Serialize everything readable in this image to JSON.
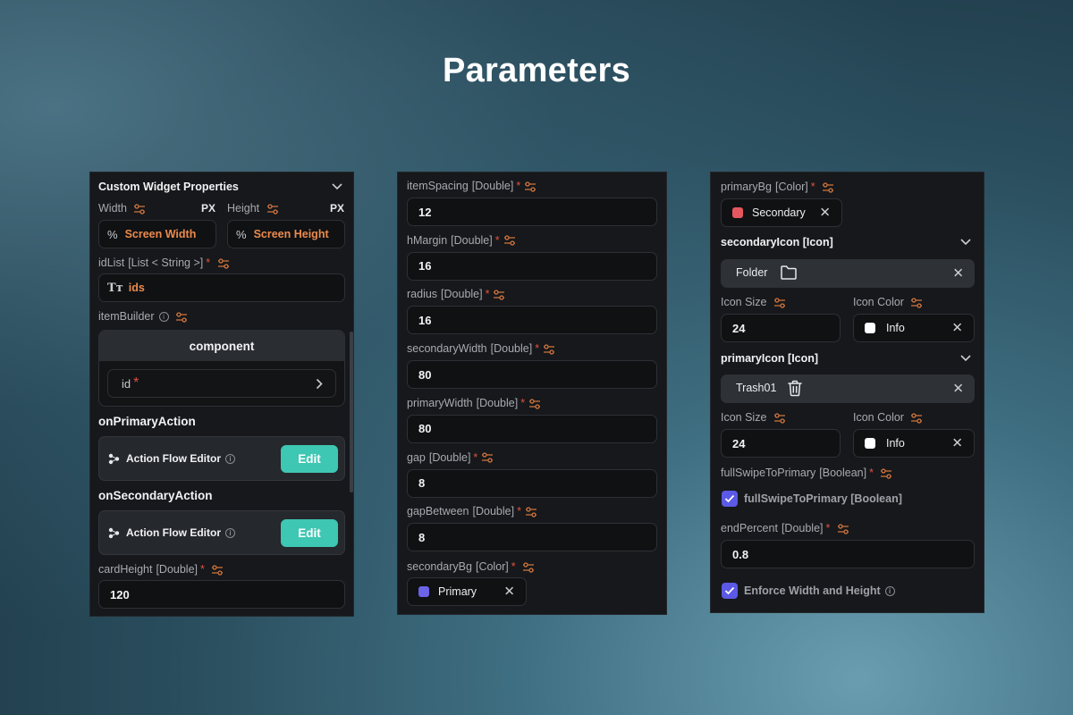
{
  "page_title": "Parameters",
  "panel1": {
    "header": "Custom Widget Properties",
    "width_label": "Width",
    "width_unit": "PX",
    "height_label": "Height",
    "height_unit": "PX",
    "width_value": "Screen Width",
    "height_value": "Screen Height",
    "idlist_label": "idList",
    "idlist_type": "[List < String >]",
    "idlist_value": "ids",
    "itembuilder_label": "itemBuilder",
    "component_label": "component",
    "id_label": "id",
    "on_primary_action": "onPrimaryAction",
    "on_secondary_action": "onSecondaryAction",
    "action_flow_editor": "Action Flow Editor",
    "edit_label": "Edit",
    "cardheight_label": "cardHeight",
    "cardheight_type": "[Double]",
    "cardheight_value": "120"
  },
  "panel2": {
    "fields": [
      {
        "name": "itemSpacing",
        "type": "[Double]",
        "value": "12"
      },
      {
        "name": "hMargin",
        "type": "[Double]",
        "value": "16"
      },
      {
        "name": "radius",
        "type": "[Double]",
        "value": "16"
      },
      {
        "name": "secondaryWidth",
        "type": "[Double]",
        "value": "80"
      },
      {
        "name": "primaryWidth",
        "type": "[Double]",
        "value": "80"
      },
      {
        "name": "gap",
        "type": "[Double]",
        "value": "8"
      },
      {
        "name": "gapBetween",
        "type": "[Double]",
        "value": "8"
      }
    ],
    "secondarybg_label": "secondaryBg",
    "secondarybg_type": "[Color]",
    "secondarybg_value": "Primary",
    "secondarybg_color": "#6b63e8"
  },
  "panel3": {
    "primarybg_label": "primaryBg",
    "primarybg_type": "[Color]",
    "primarybg_value": "Secondary",
    "primarybg_color": "#e5575e",
    "secondary_icon_label": "secondaryIcon",
    "secondary_icon_type": "[Icon]",
    "secondary_icon_value": "Folder",
    "icon_size_label": "Icon Size",
    "icon_color_label": "Icon Color",
    "secondary_icon_size": "24",
    "secondary_icon_color": "Info",
    "primary_icon_label": "primaryIcon",
    "primary_icon_type": "[Icon]",
    "primary_icon_value": "Trash01",
    "primary_icon_size": "24",
    "primary_icon_color": "Info",
    "fullswipe_label": "fullSwipeToPrimary",
    "fullswipe_type": "[Boolean]",
    "fullswipe_check_label": "fullSwipeToPrimary",
    "fullswipe_check_type": "[Boolean]",
    "endpercent_label": "endPercent",
    "endpercent_type": "[Double]",
    "endpercent_value": "0.8",
    "enforce_label": "Enforce Width and Height"
  },
  "colors": {
    "accent_teal": "#3ec7b3",
    "accent_orange": "#ec8a4c",
    "required_red": "#e2503f",
    "checkbox_purple": "#5b59e6"
  }
}
